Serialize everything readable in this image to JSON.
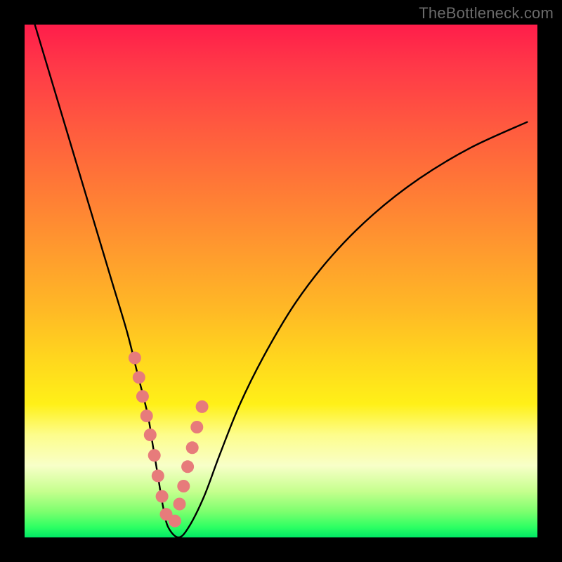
{
  "watermark": "TheBottleneck.com",
  "chart_data": {
    "type": "line",
    "title": "",
    "xlabel": "",
    "ylabel": "",
    "xlim": [
      0,
      100
    ],
    "ylim": [
      0,
      100
    ],
    "grid": false,
    "series": [
      {
        "name": "bottleneck-curve",
        "x": [
          2,
          5,
          8,
          11,
          14,
          17,
          20,
          22,
          24,
          25,
          26,
          27,
          28,
          30,
          32,
          35,
          38,
          42,
          47,
          53,
          60,
          68,
          77,
          87,
          98
        ],
        "y": [
          100,
          90,
          80,
          70,
          60,
          50,
          40,
          32,
          24,
          18,
          12,
          6,
          2,
          0,
          2,
          8,
          16,
          26,
          36,
          46,
          55,
          63,
          70,
          76,
          81
        ],
        "color": "#000000"
      },
      {
        "name": "marker-dots",
        "type": "scatter",
        "x": [
          21.5,
          22.3,
          23.0,
          23.8,
          24.5,
          25.3,
          26.0,
          26.8,
          27.6,
          29.3,
          30.2,
          31.0,
          31.8,
          32.7,
          33.6,
          34.6
        ],
        "y": [
          35.0,
          31.2,
          27.5,
          23.7,
          20.0,
          16.0,
          12.0,
          8.0,
          4.5,
          3.2,
          6.5,
          10.0,
          13.8,
          17.5,
          21.5,
          25.5
        ],
        "color": "#e77b7b"
      }
    ]
  }
}
